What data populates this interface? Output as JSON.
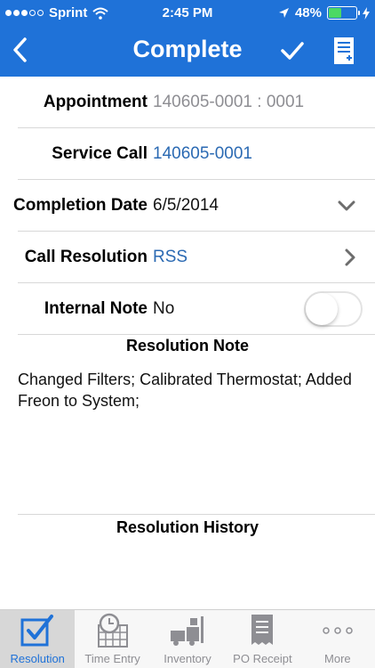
{
  "status_bar": {
    "carrier": "Sprint",
    "time": "2:45 PM",
    "battery": "48%",
    "battery_level": 0.48
  },
  "nav": {
    "title": "Complete"
  },
  "rows": {
    "appointment": {
      "label": "Appointment",
      "value": "140605-0001 : 0001"
    },
    "service_call": {
      "label": "Service Call",
      "value": "140605-0001"
    },
    "completion_date": {
      "label": "Completion Date",
      "value": "6/5/2014"
    },
    "call_resolution": {
      "label": "Call Resolution",
      "value": "RSS"
    },
    "internal_note": {
      "label": "Internal Note",
      "value": "No",
      "toggle_on": false
    }
  },
  "resolution_note": {
    "title": "Resolution Note",
    "text": "Changed Filters; Calibrated Thermostat; Added Freon to System;"
  },
  "resolution_history": {
    "title": "Resolution History"
  },
  "tabs": [
    {
      "label": "Resolution",
      "icon": "resolution-checkbox-icon",
      "active": true
    },
    {
      "label": "Time Entry",
      "icon": "clock-calendar-icon",
      "active": false
    },
    {
      "label": "Inventory",
      "icon": "forklift-icon",
      "active": false
    },
    {
      "label": "PO Receipt",
      "icon": "receipt-icon",
      "active": false
    },
    {
      "label": "More",
      "icon": "more-dots-icon",
      "active": false
    }
  ],
  "colors": {
    "accent": "#1f72d8",
    "link_blue": "#2b6ab3",
    "gray_value": "#8e8e93"
  }
}
